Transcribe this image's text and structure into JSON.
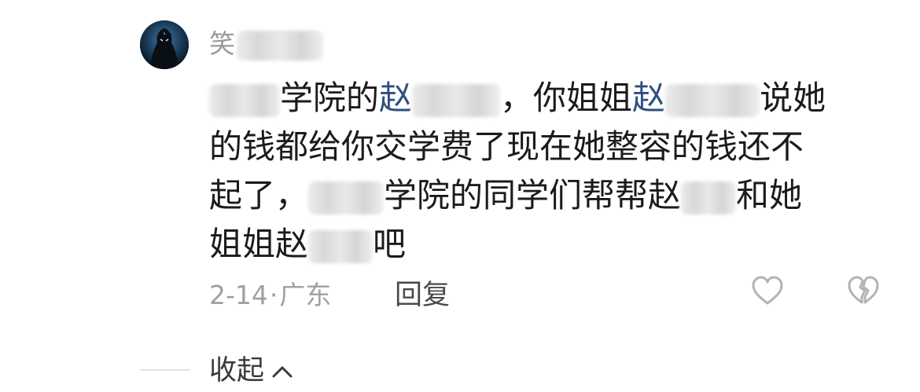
{
  "comment": {
    "username_visible": "笑",
    "lines": [
      {
        "parts": [
          {
            "type": "blur",
            "w": 90
          },
          {
            "type": "text",
            "text": "学院的"
          },
          {
            "type": "mention",
            "text": "赵"
          },
          {
            "type": "blur",
            "w": 112
          },
          {
            "type": "text",
            "text": "，你姐姐"
          },
          {
            "type": "mention",
            "text": "赵"
          },
          {
            "type": "blur",
            "w": 120
          },
          {
            "type": "text",
            "text": "说她"
          }
        ]
      },
      {
        "parts": [
          {
            "type": "text",
            "text": "的钱都给你交学费了现在她整容的钱还不"
          }
        ]
      },
      {
        "parts": [
          {
            "type": "text",
            "text": "起了，"
          },
          {
            "type": "blur",
            "w": 96
          },
          {
            "type": "text",
            "text": "学院的同学们帮帮赵"
          },
          {
            "type": "blur",
            "w": 70
          },
          {
            "type": "text",
            "text": "和她"
          }
        ]
      },
      {
        "parts": [
          {
            "type": "text",
            "text": "姐姐赵"
          },
          {
            "type": "blur",
            "w": 82
          },
          {
            "type": "text",
            "text": "吧"
          }
        ]
      }
    ],
    "date": "2-14",
    "separator": "·",
    "location": "广东",
    "reply_label": "回复",
    "collapse_label": "收起"
  },
  "icons": {
    "avatar": "avatar-dark-figure",
    "like": "heart-outline-icon",
    "dislike": "broken-heart-outline-icon",
    "collapse": "chevron-up-icon"
  },
  "colors": {
    "mention": "#2e4f80",
    "text": "#1b1b1b",
    "meta": "#a0a0a0",
    "icon": "#b3b3b3"
  }
}
